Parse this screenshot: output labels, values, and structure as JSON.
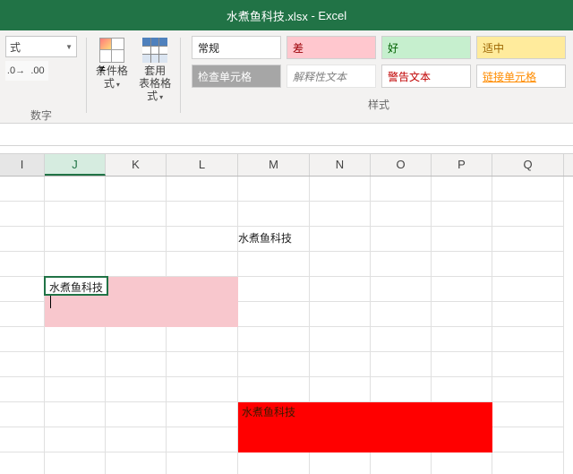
{
  "title": {
    "filename": "水煮鱼科技.xlsx",
    "app": "Excel"
  },
  "ribbon": {
    "number_group_label": "数字",
    "number_format": "式",
    "cond_fmt": "条件格式",
    "table_fmt": "套用\n表格格式",
    "styles_label": "样式",
    "styles": {
      "normal": "常规",
      "bad": "差",
      "good": "好",
      "neutral": "适中",
      "check": "检查单元格",
      "explain": "解释性文本",
      "warn": "警告文本",
      "link": "链接单元格"
    }
  },
  "columns": [
    "I",
    "J",
    "K",
    "L",
    "M",
    "N",
    "O",
    "P",
    "Q"
  ],
  "active_column": "J",
  "cells": {
    "M_r2": "水煮鱼科技",
    "editing": "水煮鱼科技",
    "red_text": "水煮鱼科技"
  },
  "chart_data": null
}
